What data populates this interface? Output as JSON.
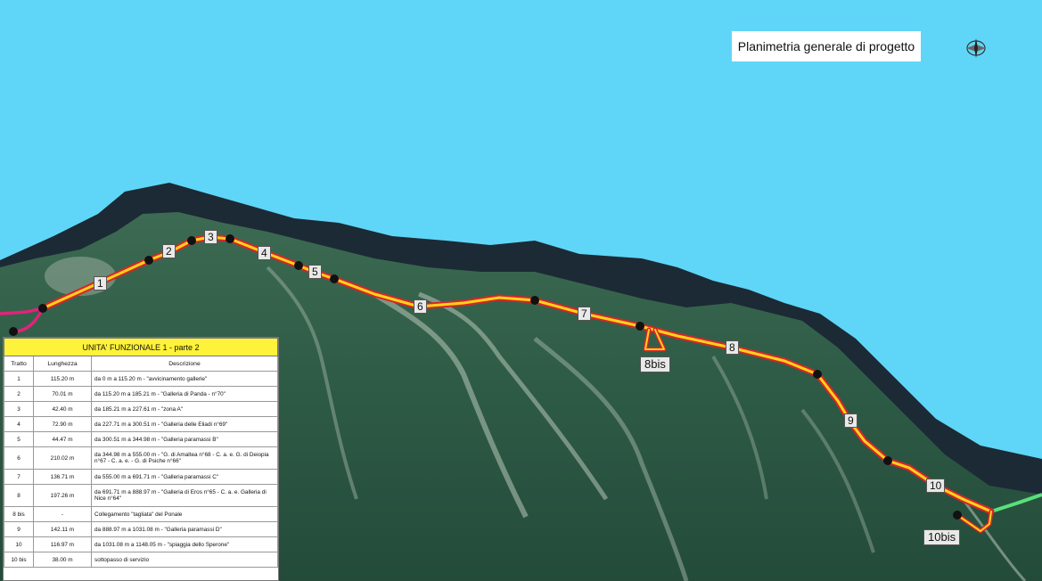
{
  "title": "Planimetria generale di progetto",
  "compass_icon": "compass-rose-icon",
  "colors": {
    "sea": "#5fd6f7",
    "lake_shadow": "#1c2a35",
    "route_main": "#ffd21a",
    "route_edge": "#d6252a",
    "start_connector": "#e2227a",
    "end_connector": "#58e07a",
    "table_header": "#fff23a"
  },
  "segment_labels": [
    "1",
    "2",
    "3",
    "4",
    "5",
    "6",
    "7",
    "8",
    "8bis",
    "9",
    "10",
    "10bis"
  ],
  "table": {
    "title": "UNITA' FUNZIONALE 1 - parte 2",
    "columns": [
      "Tratto",
      "Lunghezza",
      "Descrizione"
    ],
    "rows": [
      {
        "tratto": "1",
        "lunghezza": "115.20 m",
        "descrizione": "da 0 m a 115.20 m - \"avvicinamento gallerie\""
      },
      {
        "tratto": "2",
        "lunghezza": "70.01 m",
        "descrizione": "da 115.20 m a 185.21 m - \"Galleria di Panda - n°70\""
      },
      {
        "tratto": "3",
        "lunghezza": "42.40 m",
        "descrizione": "da 185.21 m a 227.61 m - \"zona A\""
      },
      {
        "tratto": "4",
        "lunghezza": "72.90 m",
        "descrizione": "da 227.71 m a 300.51 m - \"Galleria delle Eliadi n°69\""
      },
      {
        "tratto": "5",
        "lunghezza": "44.47 m",
        "descrizione": "da 300.51 m a 344.98 m - \"Galleria paramassi B\""
      },
      {
        "tratto": "6",
        "lunghezza": "210.02 m",
        "descrizione": "da 344.98 m a 555.00 m - \"G. di Amaltea n°68 - C. a. e. G. di Deiopia n°67 - C. a. e. - G. di Psiche n°66\""
      },
      {
        "tratto": "7",
        "lunghezza": "136.71 m",
        "descrizione": "da 555.00 m a 691.71 m - \"Galleria paramassi C\""
      },
      {
        "tratto": "8",
        "lunghezza": "197.26 m",
        "descrizione": "da 691.71 m a 888.97 m - \"Galleria di Eros n°65 - C. a. e. Galleria di Nice n°64\""
      },
      {
        "tratto": "8 bis",
        "lunghezza": "-",
        "descrizione": "Collegamento \"tagliata\" del Ponale"
      },
      {
        "tratto": "9",
        "lunghezza": "142.11 m",
        "descrizione": "da 888.97 m a 1031.08 m - \"Galleria paramassi D\""
      },
      {
        "tratto": "10",
        "lunghezza": "116.97 m",
        "descrizione": "da 1031.08 m a 1148.05 m - \"spiaggia dello Sperone\""
      },
      {
        "tratto": "10 bis",
        "lunghezza": "38.00 m",
        "descrizione": "sottopasso di servizio"
      }
    ]
  }
}
